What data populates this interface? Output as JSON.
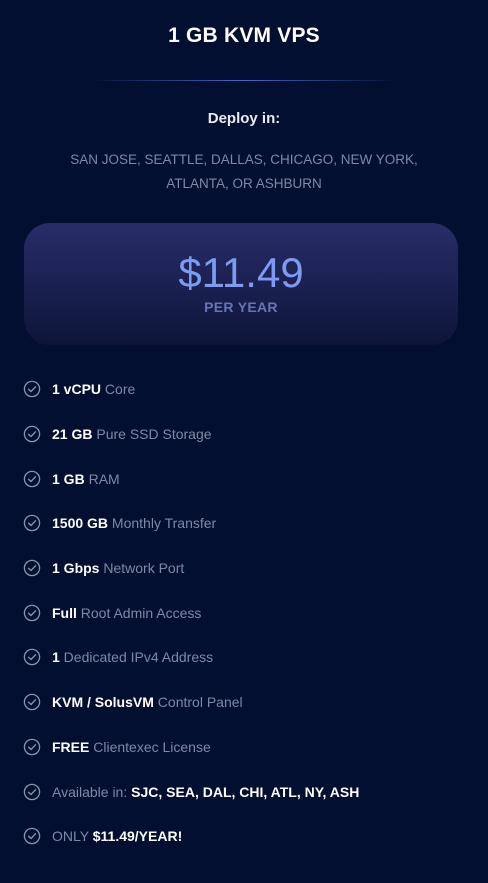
{
  "plan": {
    "title": "1 GB KVM VPS",
    "deploy_label": "Deploy in:",
    "locations": "SAN JOSE, SEATTLE, DALLAS, CHICAGO, NEW YORK, ATLANTA, OR ASHBURN",
    "price": "$11.49",
    "period": "PER YEAR"
  },
  "features": [
    {
      "strong": "1 vCPU",
      "text": " Core"
    },
    {
      "strong": "21 GB",
      "text": " Pure SSD Storage"
    },
    {
      "strong": "1 GB",
      "text": " RAM"
    },
    {
      "strong": "1500 GB",
      "text": " Monthly Transfer"
    },
    {
      "strong": "1 Gbps",
      "text": " Network Port"
    },
    {
      "strong": "Full",
      "text": " Root Admin Access"
    },
    {
      "strong": "1",
      "text": " Dedicated IPv4 Address"
    },
    {
      "strong": "KVM / SolusVM",
      "text": " Control Panel"
    },
    {
      "strong": "FREE",
      "text": " Clientexec License"
    },
    {
      "prefix": "Available in: ",
      "strong": "SJC, SEA, DAL, CHI, ATL, NY, ASH"
    },
    {
      "prefix": "ONLY ",
      "strong": "$11.49/YEAR!"
    }
  ],
  "icons": {
    "feature_bullet": "check-circle-icon"
  },
  "colors": {
    "background": "#030f30",
    "price": "#7d9bf0",
    "muted_text": "#7f88a6",
    "check_icon": "#8a93ad"
  }
}
